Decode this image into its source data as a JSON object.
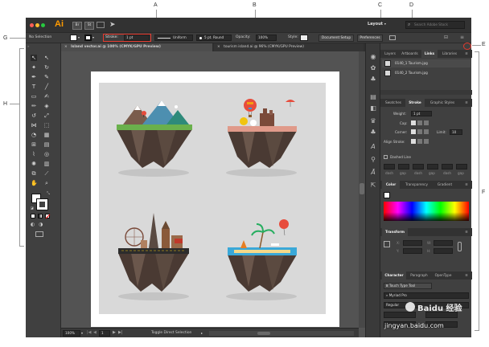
{
  "callouts": {
    "a": "A",
    "b": "B",
    "c": "C",
    "d": "D",
    "e": "E",
    "f": "F",
    "g": "G",
    "h": "H"
  },
  "menubar": {
    "app_icon": "Ai",
    "bridge_icon": "Br",
    "stock_icon": "St",
    "workspace": "Layout",
    "search_placeholder": "Search Adobe Stock",
    "icons": [
      "window-grid-icon",
      "send-icon"
    ]
  },
  "optionsbar": {
    "selection": "No Selection",
    "stroke_label": "Stroke:",
    "stroke_weight": "1 pt",
    "stroke_profile": "Uniform",
    "brush_size": "5 pt. Round",
    "opacity_label": "Opacity:",
    "opacity_value": "100%",
    "style_label": "Style:",
    "document_setup": "Document Setup",
    "preferences": "Preferences"
  },
  "tabs": [
    {
      "label": "Island vector.ai @ 100% (CMYK/GPU Preview)",
      "close": "×",
      "active": true
    },
    {
      "label": "tourism island.ai @ 96% (CMYK/GPU Preview)",
      "close": "×",
      "active": false
    }
  ],
  "statusbar": {
    "zoom": "100%",
    "page": "1",
    "info": "Toggle Direct Selection"
  },
  "links_panel": {
    "tabs": [
      "Layers",
      "Artboards",
      "Links",
      "Libraries"
    ],
    "active_tab": "Links",
    "items": [
      "0140_1 Tourism.jpg",
      "0140_2 Tourism.jpg"
    ]
  },
  "stroke_panel": {
    "tabs": [
      "Swatches",
      "Stroke",
      "Graphic Styles"
    ],
    "weight_label": "Weight:",
    "weight_value": "1 pt",
    "cap_label": "Cap:",
    "corner_label": "Corner:",
    "limit_label": "Limit:",
    "limit_value": "10",
    "align_label": "Align Stroke:",
    "dashed_label": "Dashed Line",
    "dash_labels": [
      "dash",
      "gap",
      "dash",
      "gap",
      "dash",
      "gap"
    ]
  },
  "color_panel": {
    "tabs": [
      "Color",
      "Transparency",
      "Gradient"
    ]
  },
  "transform_panel": {
    "tabs": [
      "Transform"
    ],
    "labels": [
      "X:",
      "W:",
      "Y:",
      "H:"
    ]
  },
  "character_panel": {
    "tabs": [
      "Character",
      "Paragraph",
      "OpenType"
    ],
    "touch_tool": "Touch Type Tool",
    "font": "Myriad Pro",
    "style": "Regular"
  },
  "watermark": {
    "brand": "Baidu 经验",
    "url": "jingyan.baidu.com"
  },
  "colors": {
    "accent_red": "#e63a2e",
    "ai_orange": "#ff9a00",
    "panel": "#404040",
    "pasteboard": "#535353"
  }
}
